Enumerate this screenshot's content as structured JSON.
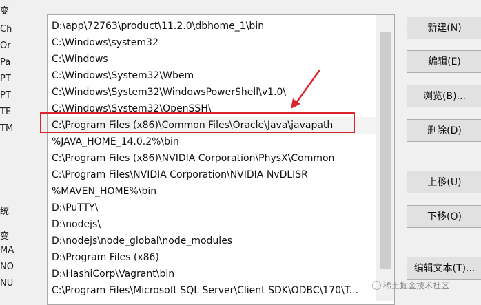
{
  "background_fragments": [
    "变",
    "Ch",
    "Or",
    "Pa",
    "PT",
    "PT",
    "TE",
    "TM",
    "统",
    "变",
    "MA",
    "NO",
    "NU"
  ],
  "path_list": [
    "D:\\app\\72763\\product\\11.2.0\\dbhome_1\\bin",
    "C:\\Windows\\system32",
    "C:\\Windows",
    "C:\\Windows\\System32\\Wbem",
    "C:\\Windows\\System32\\WindowsPowerShell\\v1.0\\",
    "C:\\Windows\\System32\\OpenSSH\\",
    "C:\\Program Files (x86)\\Common Files\\Oracle\\Java\\javapath",
    "%JAVA_HOME_14.0.2%\\bin",
    "C:\\Program Files (x86)\\NVIDIA Corporation\\PhysX\\Common",
    "C:\\Program Files\\NVIDIA Corporation\\NVIDIA NvDLISR",
    "%MAVEN_HOME%\\bin",
    "D:\\PuTTY\\",
    "D:\\nodejs\\",
    "D:\\nodejs\\node_global\\node_modules",
    "D:\\Program Files (x86)",
    "D:\\HashiCorp\\Vagrant\\bin",
    "C:\\Program Files\\Microsoft SQL Server\\Client SDK\\ODBC\\170\\T..."
  ],
  "buttons": {
    "new": "新建(N)",
    "edit": "编辑(E)",
    "browse": "浏览(B)...",
    "delete": "删除(D)",
    "move_up": "上移(U)",
    "move_down": "下移(O)",
    "edit_text": "编辑文本(T)..."
  },
  "watermark": "稀土掘金技术社区",
  "colors": {
    "highlight": "#d9262c",
    "button_bg": "#e1e1e1",
    "list_bg": "#ffffff"
  }
}
